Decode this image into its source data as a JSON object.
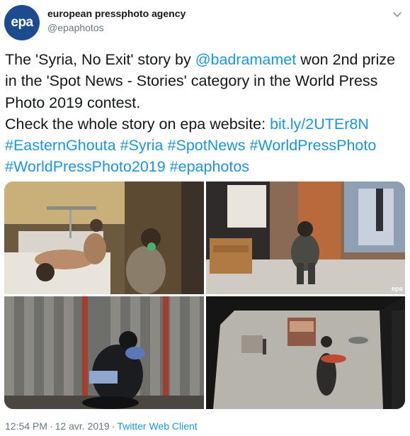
{
  "author": {
    "name": "european pressphoto agency",
    "handle": "@epaphotos",
    "avatar_text": "epa",
    "avatar_color": "#1c4b8f"
  },
  "tweet": {
    "t1": "The 'Syria, No Exit' story by ",
    "mention": "@badramamet",
    "t2": " won 2nd prize in the 'Spot News - Stories' category in the World Press Photo 2019 contest.",
    "t3": "Check the whole story on epa website: ",
    "link": "bit.ly/2UTEr8N",
    "hashtags": [
      "#EasternGhouta",
      "#Syria",
      "#SpotNews",
      "#WorldPressPhoto",
      "#WorldPressPhoto2019",
      "#epaphotos"
    ]
  },
  "photos": [
    {
      "name": "photo-1",
      "watermark": ""
    },
    {
      "name": "photo-2",
      "watermark": "epa"
    },
    {
      "name": "photo-3",
      "watermark": ""
    },
    {
      "name": "photo-4",
      "watermark": ""
    }
  ],
  "meta": {
    "time": "12:54 PM",
    "separator": "·",
    "date": "12 avr. 2019",
    "client": "Twitter Web Client"
  },
  "icons": {
    "menu": "chevron-down-icon"
  },
  "colors": {
    "link": "#1b95e0",
    "text": "#14171a",
    "secondary": "#657786"
  }
}
